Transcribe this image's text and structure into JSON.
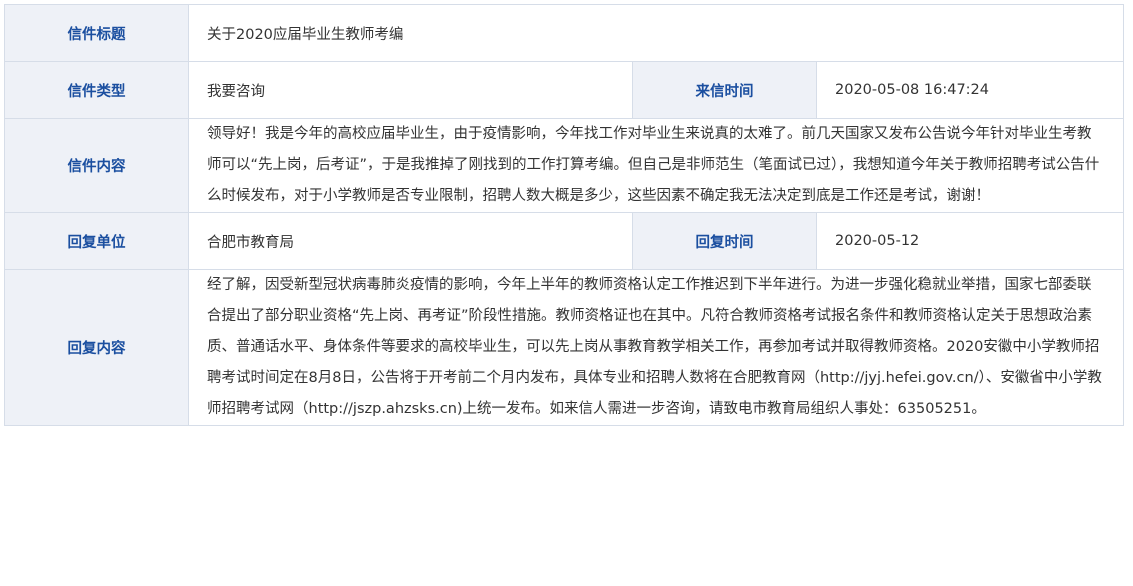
{
  "labels": {
    "title": "信件标题",
    "type": "信件类型",
    "letter_time": "来信时间",
    "content": "信件内容",
    "reply_unit": "回复单位",
    "reply_time": "回复时间",
    "reply_content": "回复内容"
  },
  "letter": {
    "title": "关于2020应届毕业生教师考编",
    "type": "我要咨询",
    "time": "2020-05-08 16:47:24",
    "content": "领导好！我是今年的高校应届毕业生，由于疫情影响，今年找工作对毕业生来说真的太难了。前几天国家又发布公告说今年针对毕业生考教师可以“先上岗，后考证”，于是我推掉了刚找到的工作打算考编。但自己是非师范生（笔面试已过），我想知道今年关于教师招聘考试公告什么时候发布，对于小学教师是否专业限制，招聘人数大概是多少，这些因素不确定我无法决定到底是工作还是考试，谢谢！"
  },
  "reply": {
    "unit": "合肥市教育局",
    "time": "2020-05-12",
    "content": "经了解，因受新型冠状病毒肺炎疫情的影响，今年上半年的教师资格认定工作推迟到下半年进行。为进一步强化稳就业举措，国家七部委联合提出了部分职业资格“先上岗、再考证”阶段性措施。教师资格证也在其中。凡符合教师资格考试报名条件和教师资格认定关于思想政治素质、普通话水平、身体条件等要求的高校毕业生，可以先上岗从事教育教学相关工作，再参加考试并取得教师资格。2020安徽中小学教师招聘考试时间定在8月8日，公告将于开考前二个月内发布，具体专业和招聘人数将在合肥教育网（http://jyj.hefei.gov.cn/）、安徽省中小学教师招聘考试网（http://jszp.ahzsks.cn)上统一发布。如来信人需进一步咨询，请致电市教育局组织人事处：63505251。"
  },
  "colors": {
    "label_text": "#1b4fa0",
    "label_background": "#eef1f7",
    "border": "#d6dde8",
    "body_text": "#333333"
  }
}
